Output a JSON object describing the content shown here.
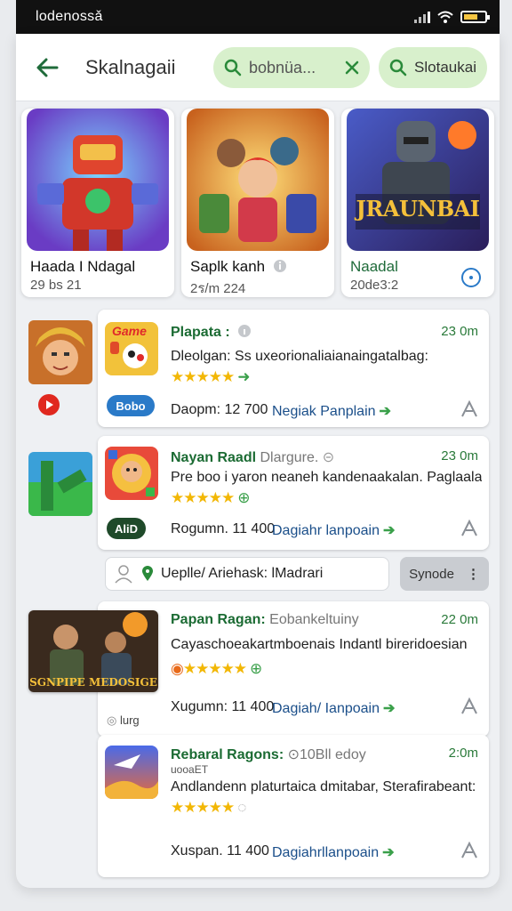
{
  "status_bar": {
    "time": "lodenossǎ",
    "battery_level": 0.7
  },
  "header": {
    "title": "Skalnagaii",
    "search": {
      "query": "bobnüa...",
      "icon": "search-icon",
      "clear_icon": "close-icon"
    },
    "action_button": {
      "label": "Slotaukai",
      "icon": "search-icon"
    }
  },
  "featured": [
    {
      "name": "Haada I Ndagal",
      "sub": "29 bs 21"
    },
    {
      "name": "Saplk kanh",
      "sub": "2ร/m 224"
    },
    {
      "name": "Naadal",
      "sub": "20de3:2",
      "banner_text": "JRAUNBAI"
    }
  ],
  "colors": {
    "accent_green": "#2a8a3a",
    "pill_bg": "#d8f0cc",
    "star": "#f2b705",
    "link": "#1b4f8a"
  },
  "list": [
    {
      "title": "Plapata :",
      "time": "23 0m",
      "desc": "Dleolgan: Ss uxeorionaliaianaingatalbag:",
      "stars": "★★★★★",
      "footer": "Daopm: 12 700",
      "link": "Negiak Panplain",
      "thumb_label": "Game",
      "side_badge": "Bobo"
    },
    {
      "title": "Nayan Raadl",
      "subtitle": "Dlargure.",
      "time": "23 0m",
      "desc": "Pre boo i yaron neaneh kandenaakalan. Paglaalat.",
      "stars": "★★★★★",
      "footer": "Rogumn. 11 400",
      "link": "Dagiahr lanpoain",
      "side_badge": "AliD"
    },
    {
      "title": "Papan Ragan:",
      "subtitle": "Eobankeltuiny",
      "time": "22 0m",
      "desc": "Cayaschoeakartmboenais Indantl bireridoesian",
      "stars": "★★★★★",
      "footer": "Xugumn: 11 400",
      "link": "Dagiah/ Ianpoain",
      "side_banner": "SGNPIPE MEDOSIGE",
      "side_badge": "lurg"
    },
    {
      "title": "Rebaral Ragons:",
      "subtitle": "⊙10Bll edoy",
      "time": "2:0m",
      "desc": "Andlandenn platurtaica dmitabar, Sterafirabeant:",
      "subdesc": "uooaET",
      "stars": "★★★★★",
      "footer": "Xuspan. 11 400",
      "link": "Dagiahrllanpoain"
    }
  ],
  "update_bar": {
    "text": "Ueplle/ Ariehask: lMadrari"
  },
  "sort_button": {
    "label": "Synode"
  }
}
